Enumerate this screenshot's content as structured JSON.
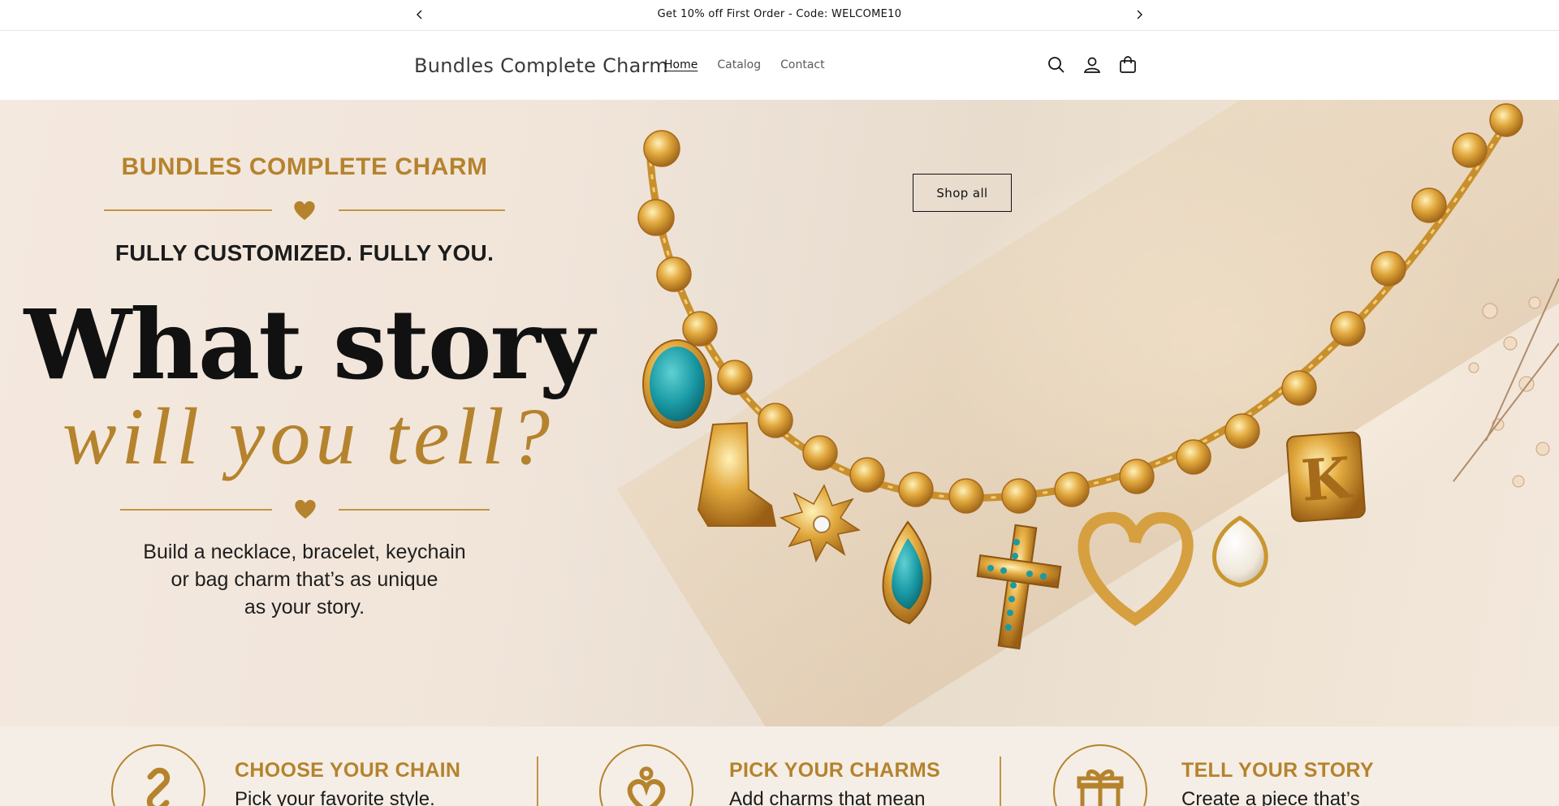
{
  "announcement": {
    "text": "Get 10% off First Order - Code: WELCOME10",
    "prev_icon": "chevron-left-icon",
    "next_icon": "chevron-right-icon"
  },
  "header": {
    "logo": "Bundles Complete Charm",
    "nav": [
      {
        "label": "Home",
        "active": true
      },
      {
        "label": "Catalog",
        "active": false
      },
      {
        "label": "Contact",
        "active": false
      }
    ],
    "icons": [
      "search-icon",
      "account-icon",
      "cart-icon"
    ]
  },
  "hero": {
    "brand_title": "BUNDLES COMPLETE CHARM",
    "tagline": "FULLY CUSTOMIZED. FULLY YOU.",
    "headline": "What story",
    "script_line": "will you tell?",
    "subcopy": [
      "Build a necklace, bracelet, keychain",
      "or bag charm that’s as unique",
      "as your story."
    ],
    "shop_button": "Shop all",
    "charm_letter": "K",
    "accent_color": "#b5832d"
  },
  "steps": [
    {
      "title": "CHOOSE YOUR CHAIN",
      "text": "Pick your favorite style.",
      "icon": "chain-link-icon"
    },
    {
      "title": "PICK YOUR CHARMS",
      "text": "Add charms that mean",
      "icon": "heart-charm-icon"
    },
    {
      "title": "TELL YOUR STORY",
      "text": "Create a piece that’s",
      "icon": "gift-icon"
    }
  ]
}
